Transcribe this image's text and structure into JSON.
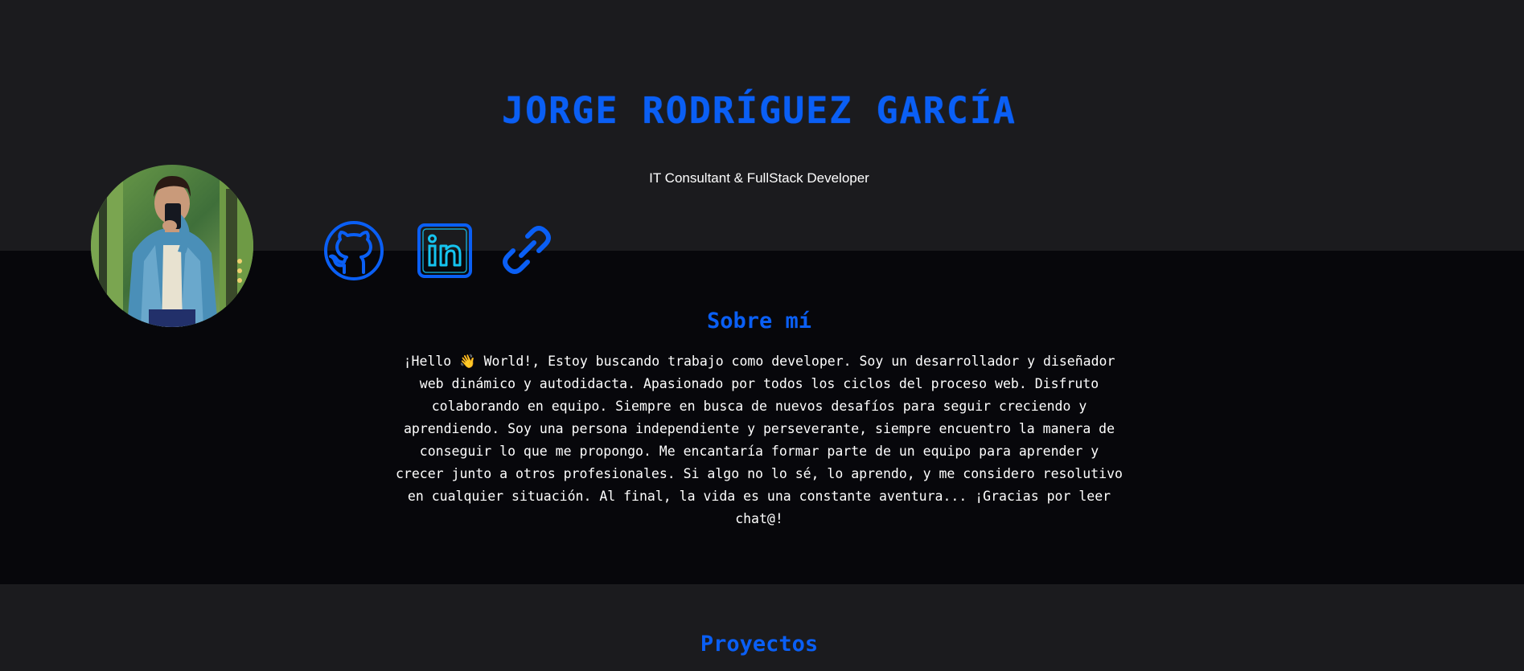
{
  "header": {
    "name": "JORGE RODRÍGUEZ GARCÍA",
    "tagline": "IT Consultant & FullStack Developer"
  },
  "avatar": {
    "icon": "profile-photo"
  },
  "social_links": [
    {
      "icon": "github-icon",
      "label": "GitHub"
    },
    {
      "icon": "linkedin-icon",
      "label": "LinkedIn"
    },
    {
      "icon": "link-icon",
      "label": "Link"
    }
  ],
  "about": {
    "heading": "Sobre mí",
    "text": "¡Hello 👋 World!, Estoy buscando trabajo como developer. Soy un desarrollador y diseñador web dinámico y autodidacta. Apasionado por todos los ciclos del proceso web. Disfruto colaborando en equipo. Siempre en busca de nuevos desafíos para seguir creciendo y aprendiendo. Soy una persona independiente y perseverante, siempre encuentro la manera de conseguir lo que me propongo. Me encantaría formar parte de un equipo para aprender y crecer junto a otros profesionales. Si algo no lo sé, lo aprendo, y me considero resolutivo en cualquier situación. Al final, la vida es una constante aventura... ¡Gracias por leer chat@!"
  },
  "projects": {
    "heading": "Proyectos"
  },
  "colors": {
    "accent": "#0a5ff5",
    "header_bg": "#1b1b1e",
    "about_bg": "#07070b",
    "text": "#ffffff"
  }
}
